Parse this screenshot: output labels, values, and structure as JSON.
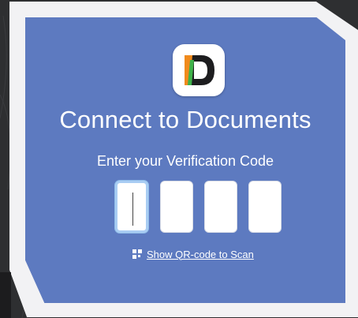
{
  "dialog": {
    "title": "Connect to Documents",
    "subtitle": "Enter your Verification Code",
    "code_digits": [
      "",
      "",
      "",
      ""
    ],
    "qr_link_label": "Show QR-code to Scan"
  },
  "icons": {
    "app_logo": "documents-app-logo",
    "qr": "qr-code-icon"
  },
  "colors": {
    "panel": "#5d7ac0",
    "frame": "#f2f2f4",
    "background": "#2e2f31",
    "logo_d": "#1d1d1f",
    "logo_orange": "#f08a1c",
    "logo_green": "#3fb24a",
    "active_field_border": "#a9cdf3"
  }
}
